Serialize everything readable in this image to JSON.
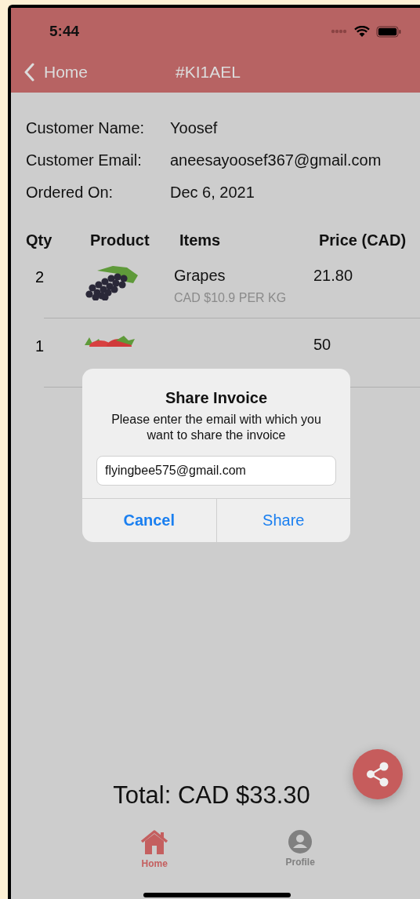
{
  "status_bar": {
    "time": "5:44"
  },
  "nav": {
    "back_label": "Home",
    "title": "#KI1AEL"
  },
  "customer": [
    {
      "label": "Customer Name:",
      "value": "Yoosef"
    },
    {
      "label": "Customer Email:",
      "value": "aneesayoosef367@gmail.com"
    },
    {
      "label": "Ordered On:",
      "value": "Dec 6, 2021"
    }
  ],
  "table": {
    "columns": [
      "Qty",
      "Product",
      "Items",
      "Price (CAD)"
    ],
    "rows": [
      {
        "qty": "2",
        "kind": "grapes",
        "item": "Grapes",
        "unit_price": "CAD $10.9 PER KG",
        "price": "21.80"
      },
      {
        "qty": "1",
        "kind": "strawberries",
        "price": "50"
      }
    ]
  },
  "dialog": {
    "title": "Share Invoice",
    "message": "Please enter the email with which you want to share the invoice",
    "email": "flyingbee575@gmail.com",
    "buttons": [
      "Cancel",
      "Share"
    ]
  },
  "total": "Total: CAD $33.30",
  "tabs": [
    {
      "label": "Home",
      "selected": true,
      "kind": "home"
    },
    {
      "label": "Profile",
      "selected": false,
      "kind": "profile"
    }
  ]
}
